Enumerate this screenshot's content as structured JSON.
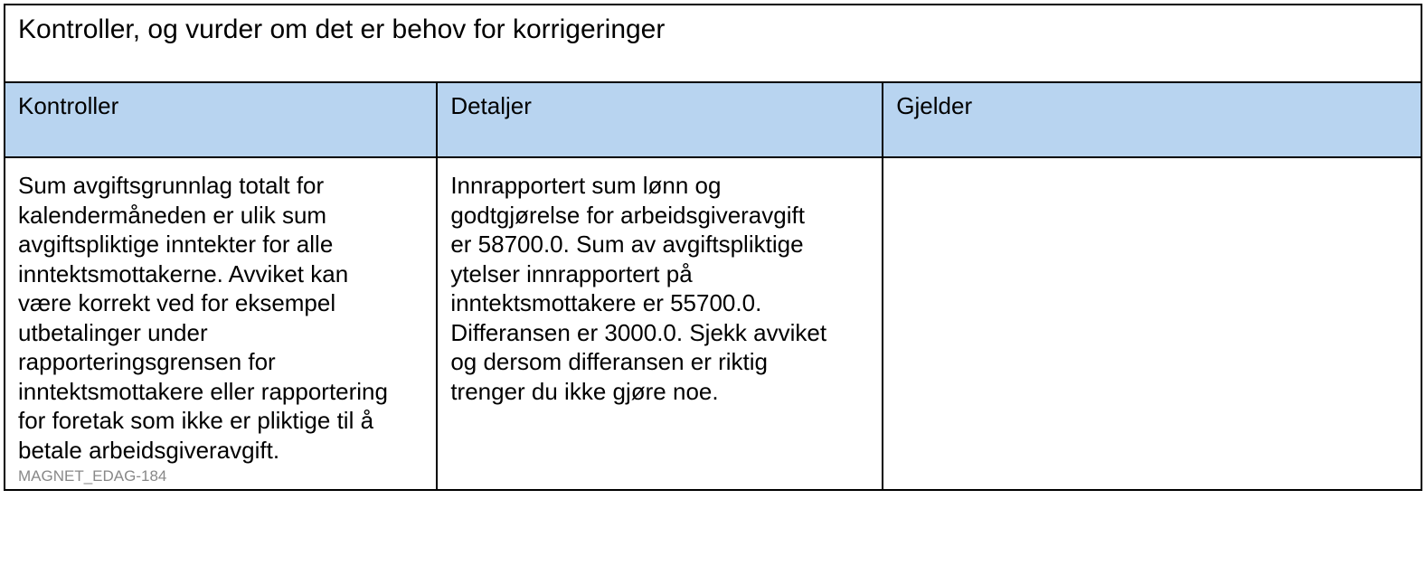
{
  "title": "Kontroller, og vurder om det er behov for korrigeringer",
  "columns": {
    "kontroller": "Kontroller",
    "detaljer": "Detaljer",
    "gjelder": "Gjelder"
  },
  "rows": [
    {
      "kontroller": "Sum avgiftsgrunnlag totalt for kalendermåneden er ulik sum avgiftspliktige inntekter  for alle inntektsmottakerne. Avviket kan være korrekt ved for eksempel utbetalinger under rapporteringsgrensen for inntektsmottakere eller rapportering for foretak som ikke er pliktige til å betale arbeidsgiveravgift.",
      "code": "MAGNET_EDAG-184",
      "detaljer": "Innrapportert sum lønn og godtgjørelse for arbeidsgiveravgift er 58700.0. Sum av avgiftspliktige ytelser innrapportert på inntektsmottakere er 55700.0. Differansen er  3000.0. Sjekk avviket og dersom differansen er riktig trenger du ikke gjøre noe.",
      "gjelder": ""
    }
  ]
}
